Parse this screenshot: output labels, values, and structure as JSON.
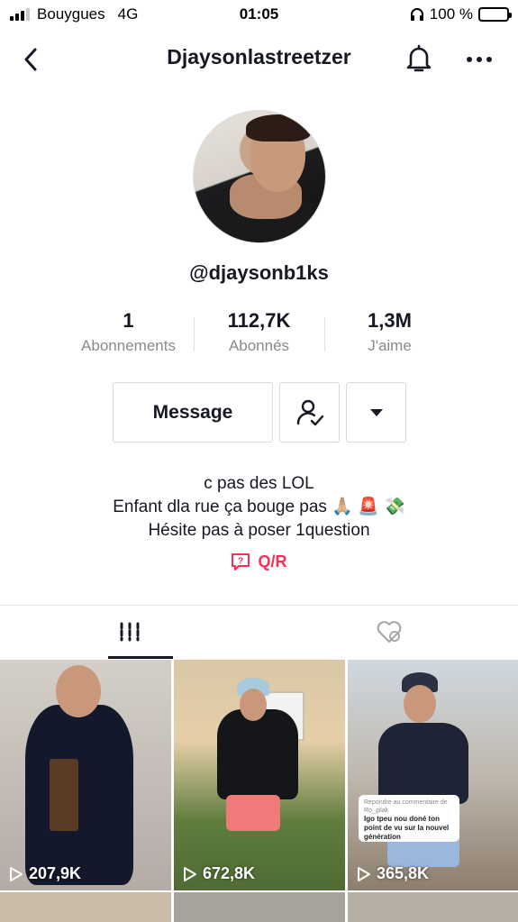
{
  "status_bar": {
    "carrier": "Bouygues",
    "network": "4G",
    "time": "01:05",
    "battery": "100 %"
  },
  "nav": {
    "title": "Djaysonlastreetzer",
    "icons": [
      "back-chevron-icon",
      "bell-icon",
      "more-dots-icon"
    ]
  },
  "profile": {
    "handle": "@djaysonb1ks",
    "stats": [
      {
        "value": "1",
        "label": "Abonnements"
      },
      {
        "value": "112,7K",
        "label": "Abonnés"
      },
      {
        "value": "1,3M",
        "label": "J'aime"
      }
    ],
    "message_label": "Message",
    "bio_lines": [
      "c pas des LOL",
      "Enfant dla rue ça bouge pas 🙏🏼 🚨 💸",
      "Hésite pas à poser 1question"
    ],
    "qa_label": "Q/R"
  },
  "tabs": [
    {
      "name": "videos",
      "icon": "grid-bars-icon",
      "active": true
    },
    {
      "name": "liked",
      "icon": "hidden-heart-icon",
      "active": false
    }
  ],
  "videos": [
    {
      "views": "207,9K"
    },
    {
      "views": "672,8K"
    },
    {
      "views": "365,8K",
      "sticker": {
        "header": "Répondre au commentaire de Ro_gilak",
        "text": "Igo tpeu nou doné ton point de vu sur la nouvel génération"
      }
    },
    {
      "views": ""
    },
    {
      "views": ""
    },
    {
      "views": ""
    }
  ],
  "colors": {
    "accent": "#fe2c55",
    "text": "#161823",
    "muted": "#8a8b91"
  }
}
